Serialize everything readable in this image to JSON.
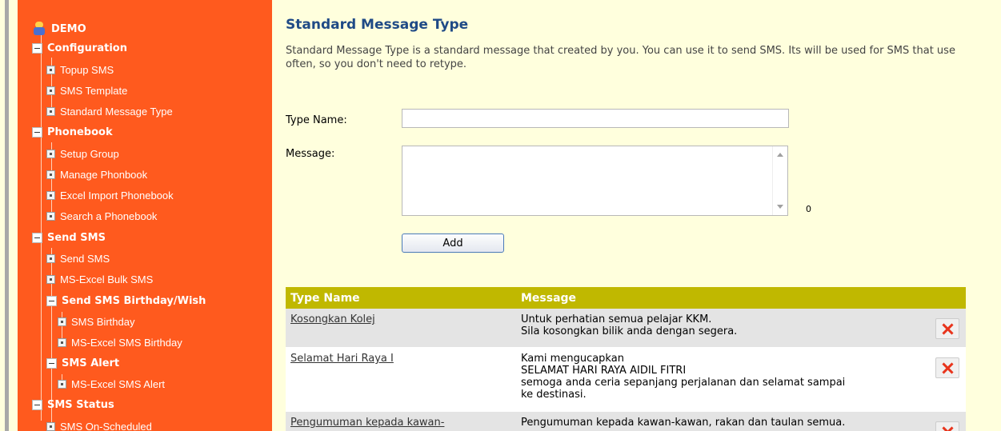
{
  "sidebar": {
    "root": "DEMO",
    "sections": [
      {
        "label": "Configuration",
        "items": [
          "Topup SMS",
          "SMS Template",
          "Standard Message Type"
        ]
      },
      {
        "label": "Phonebook",
        "items": [
          "Setup Group",
          "Manage Phonbook",
          "Excel Import Phonebook",
          "Search a Phonebook"
        ]
      },
      {
        "label": "Send SMS",
        "items": [
          "Send SMS",
          "MS-Excel Bulk SMS"
        ]
      },
      {
        "label": "Send SMS Birthday/Wish",
        "items": [
          "SMS Birthday",
          "MS-Excel SMS Birthday"
        ]
      },
      {
        "label": "SMS Alert",
        "items": [
          "MS-Excel SMS Alert"
        ]
      },
      {
        "label": "SMS Status",
        "items": [
          "SMS On-Scheduled"
        ]
      }
    ]
  },
  "page": {
    "title": "Standard Message Type",
    "description": "Standard Message Type is a standard message that created by you. You can use it to send SMS. Its will be used for SMS that use often, so you don't need to retype."
  },
  "form": {
    "type_name_label": "Type Name:",
    "type_name_value": "",
    "message_label": "Message:",
    "message_value": "",
    "char_count": "0",
    "add_label": "Add"
  },
  "table": {
    "headers": [
      "Type Name",
      "Message"
    ],
    "rows": [
      {
        "name": "Kosongkan Kolej",
        "message": "Untuk perhatian semua pelajar KKM.\nSila kosongkan bilik anda dengan segera."
      },
      {
        "name": "Selamat Hari Raya I",
        "message": "Kami mengucapkan\nSELAMAT HARI RAYA AIDIL FITRI\nsemoga anda ceria sepanjang perjalanan dan selamat sampai\nke destinasi."
      },
      {
        "name": "Pengumuman kepada kawan-",
        "message": "Pengumuman kepada kawan-kawan, rakan dan taulan semua."
      }
    ]
  },
  "colors": {
    "sidebar_bg": "#ff5a1e",
    "page_bg": "#ffffdd",
    "title": "#1f4a86",
    "table_header": "#c0b800",
    "delete_icon": "#e8341c"
  },
  "icons": [
    "user-icon",
    "collapse-icon",
    "leaf-icon",
    "delete-icon",
    "scroll-up-icon",
    "scroll-down-icon"
  ]
}
